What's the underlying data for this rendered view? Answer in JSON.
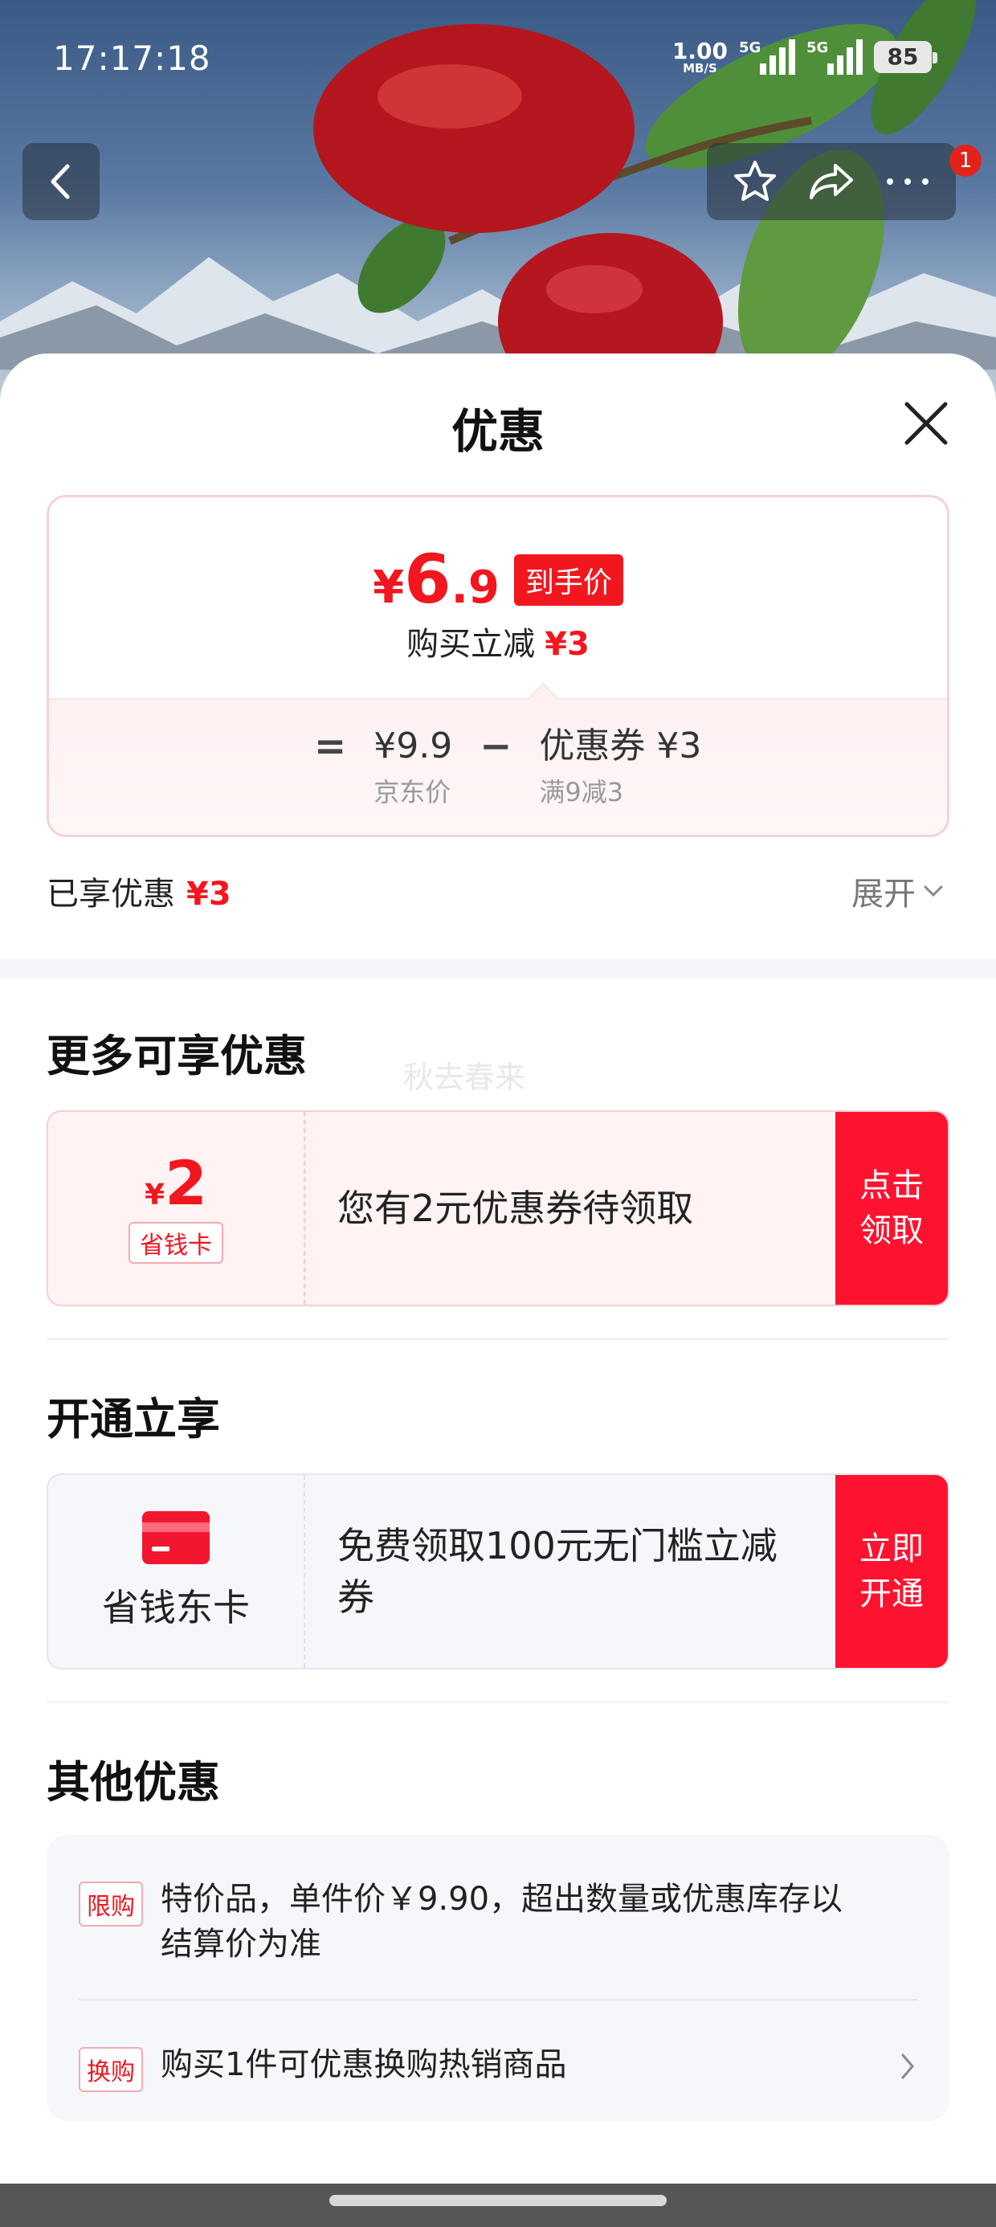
{
  "status_bar": {
    "time": "17:17:18",
    "net_speed": "1.00",
    "net_unit": "MB/S",
    "sim1_label": "5G",
    "sim2_label": "5G",
    "battery": "85"
  },
  "nav": {
    "notification_count": "1"
  },
  "sheet": {
    "title": "优惠"
  },
  "price_card": {
    "yen": "¥",
    "price_int": "6",
    "price_dec": ".9",
    "tag": "到手价",
    "instant_cut_label": "购买立减",
    "instant_cut_value": "¥3",
    "equals": "=",
    "jd_price": "¥9.9",
    "jd_price_label": "京东价",
    "minus": "−",
    "coupon_value": "优惠券 ¥3",
    "coupon_rule": "满9减3"
  },
  "enjoyed": {
    "label": "已享优惠",
    "value": "¥3",
    "expand_label": "展开"
  },
  "more_discounts": {
    "title": "更多可享优惠",
    "watermark": "秋去春来",
    "coupon": {
      "yen": "¥",
      "amount": "2",
      "tag": "省钱卡",
      "text": "您有2元优惠券待领取",
      "button": "点击领取"
    }
  },
  "open_section": {
    "title": "开通立享",
    "card_name": "省钱东卡",
    "text": "免费领取100元无门槛立减券",
    "button": "立即开通"
  },
  "other": {
    "title": "其他优惠",
    "items": [
      {
        "tag": "限购",
        "text": "特价品，单件价￥9.90，超出数量或优惠库存以结算价为准"
      },
      {
        "tag": "换购",
        "text": "购买1件可优惠换购热销商品"
      }
    ]
  },
  "colors": {
    "accent_red": "#f2161e",
    "button_red": "#fd1330",
    "light_pink": "#fff3f4"
  }
}
